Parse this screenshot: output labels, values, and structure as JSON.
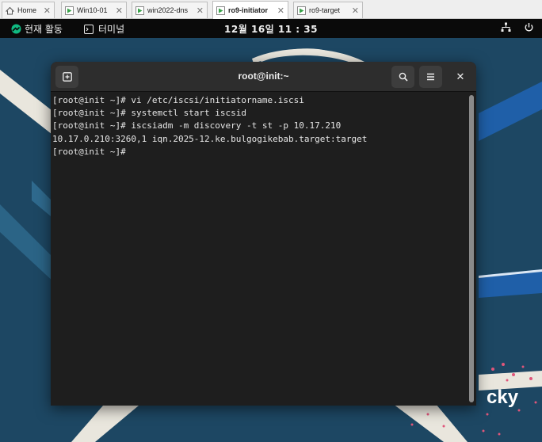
{
  "vm_tabs": [
    {
      "label": "Home",
      "icon": "home-icon",
      "active": false
    },
    {
      "label": "Win10-01",
      "icon": "vm-running-icon",
      "active": false
    },
    {
      "label": "win2022-dns",
      "icon": "vm-running-icon",
      "active": false
    },
    {
      "label": "ro9-initiator",
      "icon": "vm-running-icon",
      "active": true
    },
    {
      "label": "ro9-target",
      "icon": "vm-running-icon",
      "active": false
    }
  ],
  "topbar": {
    "activities": "현재 활동",
    "app": "터미널",
    "clock": "12월 16일  11 : 35"
  },
  "terminal": {
    "title": "root@init:~",
    "lines": [
      "[root@init ~]# vi /etc/iscsi/initiatorname.iscsi",
      "[root@init ~]# systemctl start iscsid",
      "[root@init ~]# iscsiadm -m discovery -t st -p 10.17.210",
      "10.17.0.210:3260,1 iqn.2025-12.ke.bulgogikebab.target:target",
      "[root@init ~]#"
    ]
  },
  "desktop": {
    "logo_text": "cky"
  },
  "colors": {
    "desktop_bg": "#1d4763",
    "topbar_bg": "#0a0a0a",
    "terminal_bg": "#1e1e1e",
    "terminal_header": "#2d2d2d",
    "vm_icon_green": "#3aa34a"
  }
}
